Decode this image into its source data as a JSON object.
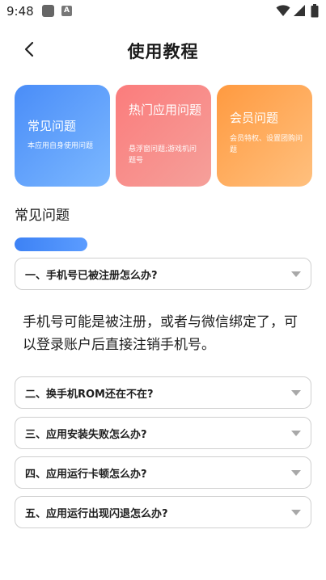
{
  "status_bar": {
    "time": "9:48",
    "notification_letter": "A"
  },
  "header": {
    "title": "使用教程"
  },
  "cards": [
    {
      "title": "常见问题",
      "subtitle": "本应用自身使用问题",
      "color": "#4a8df8"
    },
    {
      "title": "热门应用问题",
      "subtitle": "悬浮窗问题;游戏机问题号",
      "color": "#fb7c7c"
    },
    {
      "title": "会员问题",
      "subtitle": "会员特权、设置团购问题",
      "color": "#ff9a40"
    }
  ],
  "section": {
    "title": "常见问题",
    "accent": "#3d82f5"
  },
  "faq": [
    {
      "question": "一、手机号已被注册怎么办?",
      "expanded": true,
      "answer": "手机号可能是被注册，或者与微信绑定了，可以登录账户后直接注销手机号。"
    },
    {
      "question": "二、换手机ROM还在不在?",
      "expanded": false
    },
    {
      "question": "三、应用安装失败怎么办?",
      "expanded": false
    },
    {
      "question": "四、应用运行卡顿怎么办?",
      "expanded": false
    },
    {
      "question": "五、应用运行出现闪退怎么办?",
      "expanded": false
    }
  ]
}
